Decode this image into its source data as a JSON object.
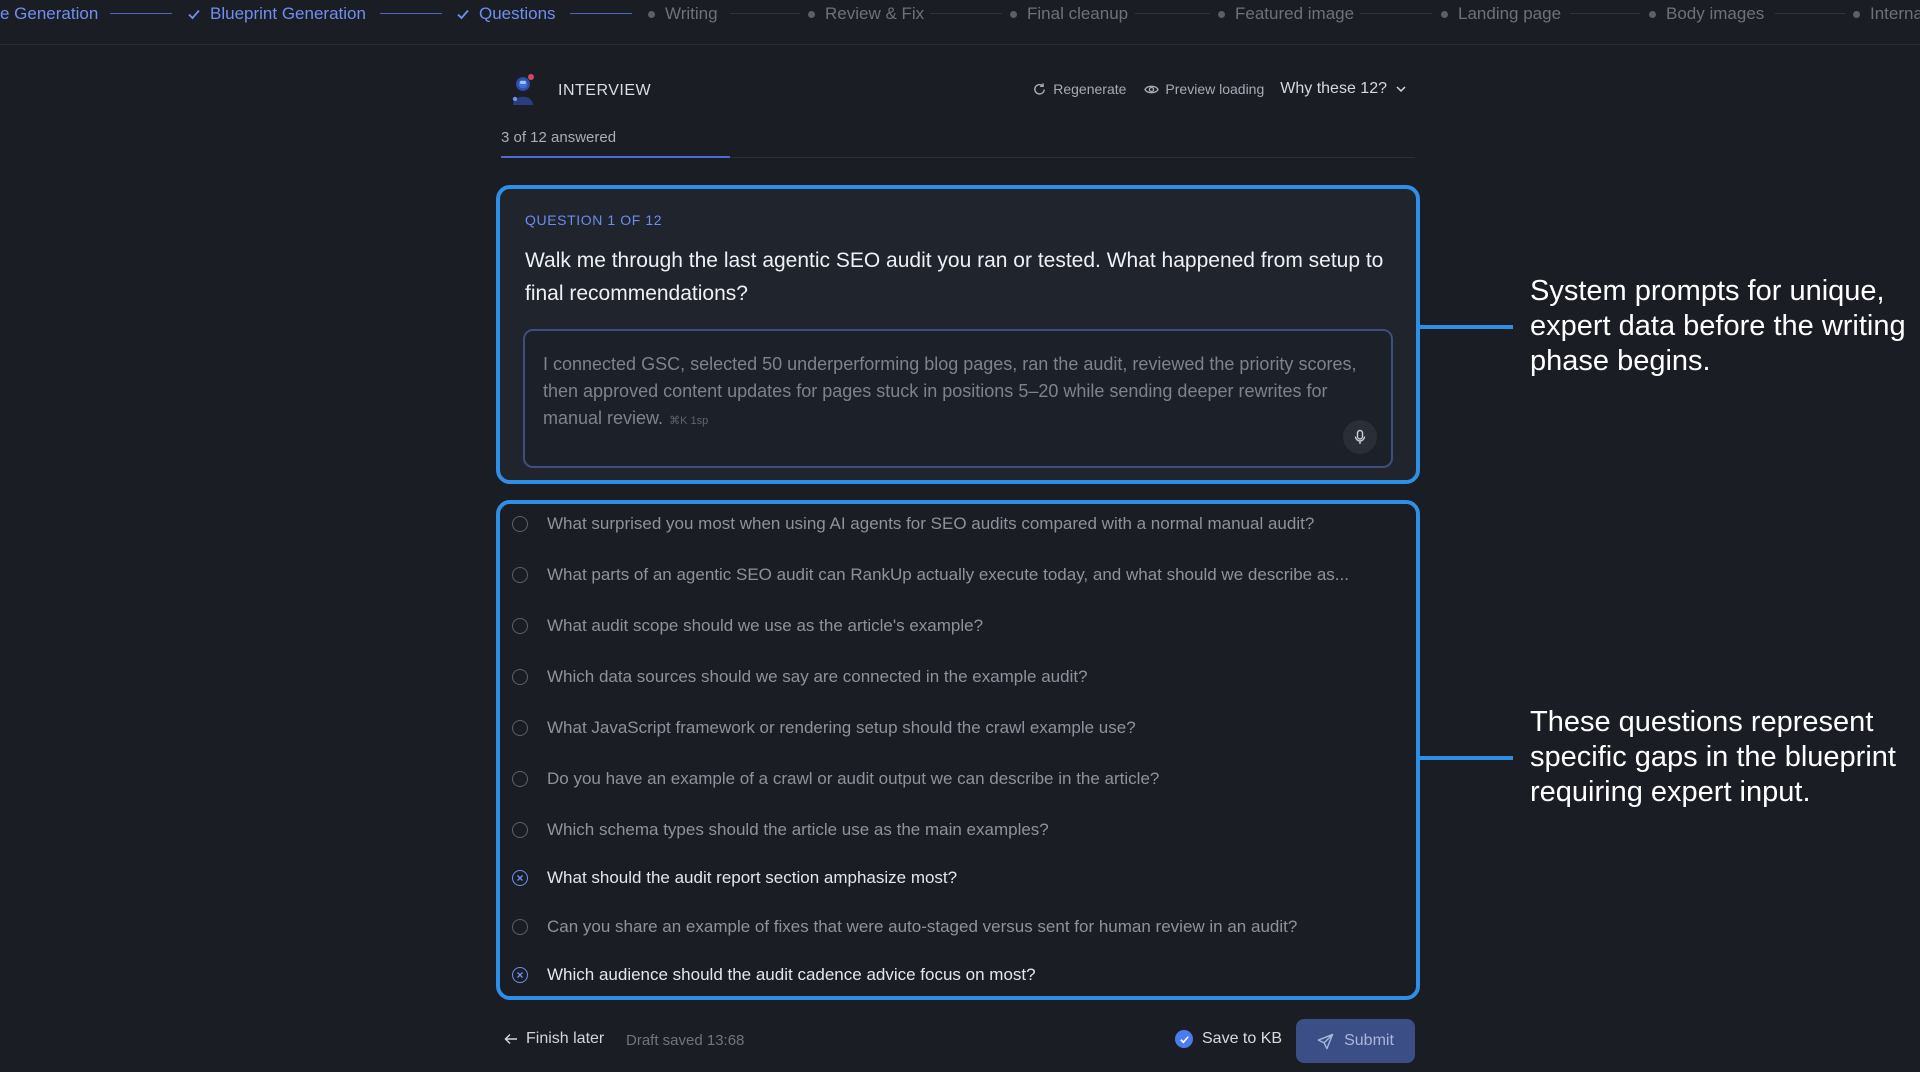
{
  "stepper": {
    "steps": [
      {
        "label": "e Generation",
        "status": "done"
      },
      {
        "label": "Blueprint Generation",
        "status": "done"
      },
      {
        "label": "Questions",
        "status": "done"
      },
      {
        "label": "Writing",
        "status": "pending"
      },
      {
        "label": "Review & Fix",
        "status": "pending"
      },
      {
        "label": "Final cleanup",
        "status": "pending"
      },
      {
        "label": "Featured image",
        "status": "pending"
      },
      {
        "label": "Landing page",
        "status": "pending"
      },
      {
        "label": "Body images",
        "status": "pending"
      },
      {
        "label": "Interna",
        "status": "pending"
      }
    ]
  },
  "header": {
    "title": "INTERVIEW",
    "regenerate_label": "Regenerate",
    "preview_label": "Preview loading",
    "why_label": "Why these 12?",
    "progress_text": "3 of 12 answered",
    "progress_answered": 3,
    "progress_total": 12
  },
  "active_question": {
    "label": "QUESTION 1 OF 12",
    "text": "Walk me through the last agentic SEO audit you ran or tested. What happened from setup to final recommendations?",
    "answer_placeholder": "I connected GSC, selected 50 underperforming blog pages, ran the audit, reviewed the priority scores, then approved content updates for pages stuck in positions 5–20 while sending deeper rewrites for manual review.",
    "answer_hint": "⌘K 1sp"
  },
  "questions": [
    {
      "text": "What surprised you most when using AI agents for SEO audits compared with a normal manual audit?",
      "answered": false
    },
    {
      "text": "What parts of an agentic SEO audit can RankUp actually execute today, and what should we describe as...",
      "answered": false
    },
    {
      "text": "What audit scope should we use as the article's example?",
      "answered": false
    },
    {
      "text": "Which data sources should we say are connected in the example audit?",
      "answered": false
    },
    {
      "text": "What JavaScript framework or rendering setup should the crawl example use?",
      "answered": false
    },
    {
      "text": "Do you have an example of a crawl or audit output we can describe in the article?",
      "answered": false
    },
    {
      "text": "Which schema types should the article use as the main examples?",
      "answered": false
    },
    {
      "text": "What should the audit report section amphasize most?",
      "answered": true
    },
    {
      "text": "Can you share an example of fixes that were auto-staged versus sent for human review in an audit?",
      "answered": false
    },
    {
      "text": "Which audience should the audit cadence advice focus on most?",
      "answered": true
    }
  ],
  "annotations": {
    "top": "System prompts for unique, expert data before the writing phase begins.",
    "bottom": "These questions represent specific gaps in the blueprint requiring expert input."
  },
  "footer": {
    "finish_label": "Finish later",
    "draft_text": "Draft saved 13:68",
    "save_kb_label": "Save to KB",
    "save_kb_checked": true,
    "submit_label": "Submit"
  },
  "colors": {
    "background": "#1a1d24",
    "accent": "#6f8ff0",
    "highlight": "#2f8ee6"
  }
}
